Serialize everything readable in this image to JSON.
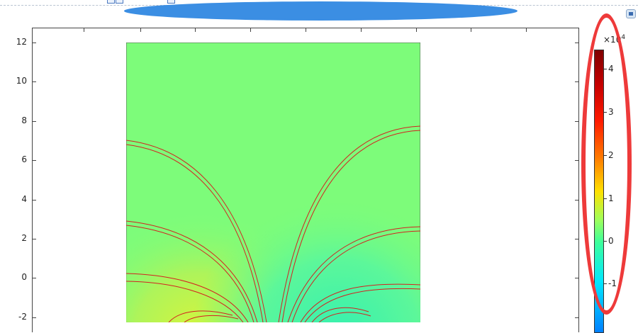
{
  "plot": {
    "title": "",
    "y_ticks": [
      "12",
      "10",
      "8",
      "6",
      "4",
      "2",
      "0",
      "-2"
    ]
  },
  "colorbar": {
    "multiplier": "×10",
    "exponent": "4",
    "ticks": [
      "4",
      "3",
      "2",
      "1",
      "0",
      "-1"
    ],
    "colormap": "rainbow"
  },
  "annotations": {
    "highlight_ellipse_color": "#ee3a3a",
    "redaction_ellipse_color": "#3b8ee3"
  },
  "colors": {
    "field_background": "#7dfc7a",
    "streamline": "#d42020"
  }
}
